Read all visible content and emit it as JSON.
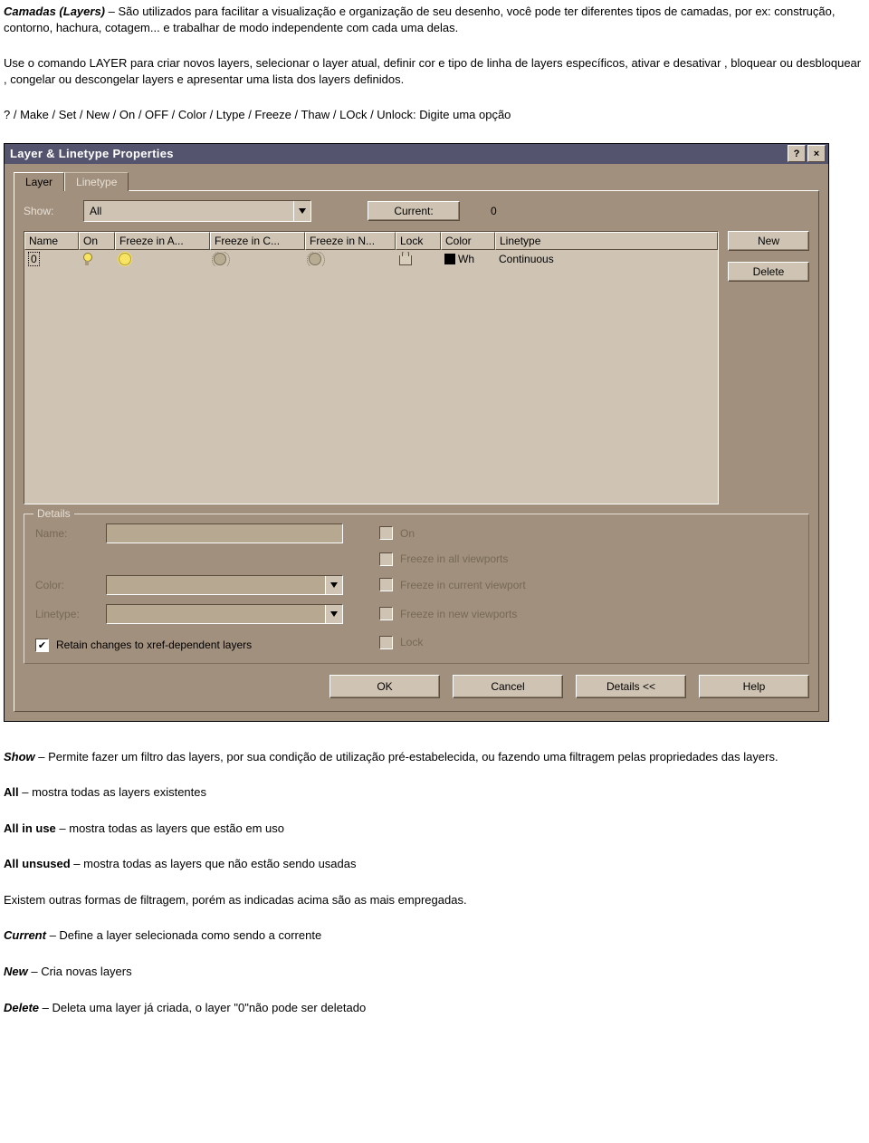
{
  "intro": {
    "heading": "Camadas (Layers)",
    "p1_rest": " – São utilizados para facilitar a visualização e organização de seu desenho, você pode ter diferentes tipos de camadas, por ex: construção, contorno, hachura, cotagem... e trabalhar de modo independente com cada uma delas.",
    "p2": "Use o comando LAYER para criar novos layers, selecionar o layer atual, definir cor e tipo de linha de layers específicos, ativar e desativar , bloquear ou desbloquear , congelar ou descongelar layers e apresentar uma lista dos layers definidos.",
    "p3": "? / Make / Set / New / On / OFF / Color / Ltype / Freeze / Thaw / LOck / Unlock: Digite uma opção"
  },
  "dialog": {
    "title": "Layer & Linetype Properties",
    "help_btn": "?",
    "close_btn": "×",
    "tabs": {
      "layer": "Layer",
      "linetype": "Linetype"
    },
    "show_label": "Show:",
    "show_value": "All",
    "current_label": "Current:",
    "current_value": "0",
    "columns": {
      "name": "Name",
      "on": "On",
      "fa": "Freeze in A...",
      "fc": "Freeze in C...",
      "fn": "Freeze in N...",
      "lock": "Lock",
      "color": "Color",
      "linetype": "Linetype"
    },
    "rows": [
      {
        "name": "0",
        "color_label": "Wh",
        "linetype": "Continuous"
      }
    ],
    "side": {
      "new": "New",
      "delete": "Delete"
    },
    "details": {
      "legend": "Details",
      "name": "Name:",
      "color": "Color:",
      "linetype": "Linetype:",
      "on": "On",
      "fav": "Freeze in all viewports",
      "fcv": "Freeze in current viewport",
      "fnv": "Freeze in new viewports",
      "lock": "Lock",
      "retain": "Retain changes to xref-dependent layers"
    },
    "buttons": {
      "ok": "OK",
      "cancel": "Cancel",
      "details": "Details <<",
      "help": "Help"
    }
  },
  "after": {
    "show_b": "Show",
    "show_rest": " – Permite fazer um filtro das layers, por sua condição de utilização pré-estabelecida, ou fazendo uma filtragem pelas propriedades das layers.",
    "all_b": "All",
    "all_rest": " – mostra todas as layers existentes",
    "inuse_b": "All in use",
    "inuse_rest": " – mostra todas as layers que estão em uso",
    "unused_b": "All unsused",
    "unused_rest": " – mostra todas as layers que não estão sendo usadas",
    "other": "Existem outras formas de filtragem, porém as indicadas acima são as mais empregadas.",
    "current_b": "Current",
    "current_rest": " – Define a layer selecionada como sendo a corrente",
    "new_b": "New",
    "new_rest": " – Cria novas layers",
    "delete_b": "Delete",
    "delete_rest": " – Deleta uma layer já criada, o layer \"0\"não pode ser deletado"
  }
}
